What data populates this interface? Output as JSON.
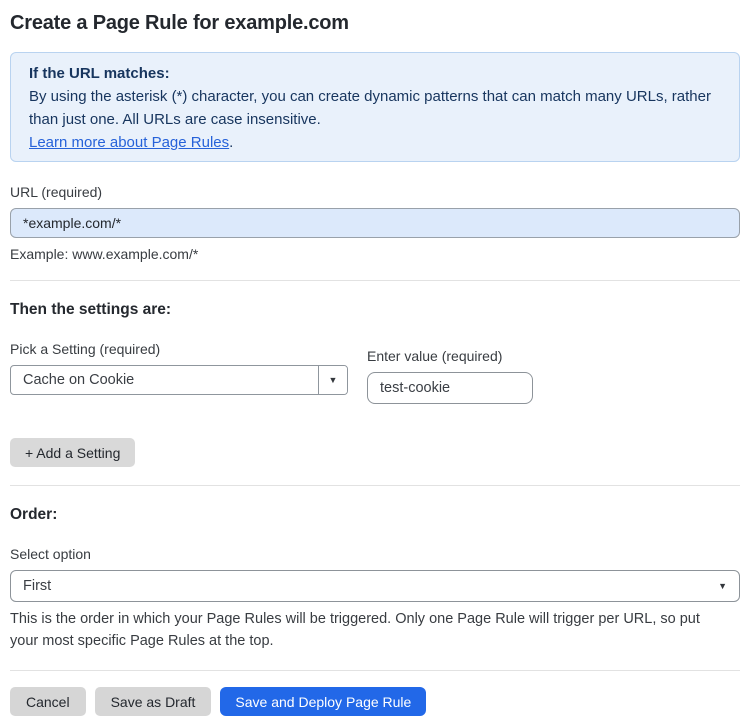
{
  "header": {
    "title": "Create a Page Rule for example.com"
  },
  "info_box": {
    "heading": "If the URL matches:",
    "body": "By using the asterisk (*) character, you can create dynamic patterns that can match many URLs, rather than just one. All URLs are case insensitive.",
    "link_label": "Learn more about Page Rules",
    "link_suffix": "."
  },
  "url_field": {
    "label": "URL (required)",
    "value": "*example.com/*",
    "example": "Example: www.example.com/*"
  },
  "settings": {
    "heading": "Then the settings are:",
    "setting_label": "Pick a Setting (required)",
    "setting_selected": "Cache on Cookie",
    "value_label": "Enter value (required)",
    "value": "test-cookie",
    "add_button_label": "+ Add a Setting",
    "dropdown_arrow": "▼"
  },
  "order": {
    "heading": "Order:",
    "label": "Select option",
    "selected": "First",
    "dropdown_arrow": "▼",
    "help": "This is the order in which your Page Rules will be triggered. Only one Page Rule will trigger per URL, so put your most specific Page Rules at the top."
  },
  "footer": {
    "cancel_label": "Cancel",
    "save_draft_label": "Save as Draft",
    "save_deploy_label": "Save and Deploy Page Rule"
  },
  "colors": {
    "info_box_bg": "#e9f1fb",
    "info_box_border": "#b9d3f0",
    "info_text": "#17355e",
    "link": "#2662d9",
    "url_input_bg": "#dce9fb",
    "divider": "#e2e2e2",
    "gray_button_bg": "#d6d6d6",
    "primary_button_bg": "#2268e8",
    "primary_button_text": "#ffffff"
  }
}
